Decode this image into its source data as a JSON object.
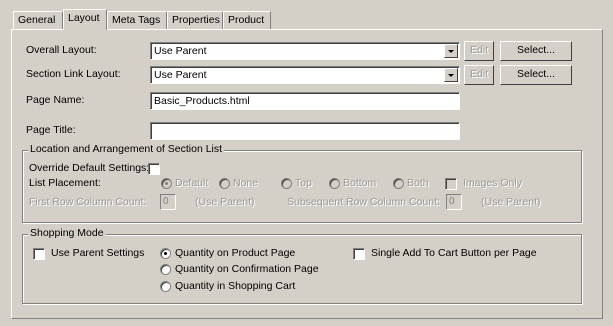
{
  "tabs": [
    "General",
    "Layout",
    "Meta Tags",
    "Properties",
    "Product"
  ],
  "layout": {
    "overall_layout": {
      "label": "Overall Layout:",
      "value": "Use Parent",
      "edit": "Edit",
      "select": "Select..."
    },
    "section_link_layout": {
      "label": "Section Link Layout:",
      "value": "Use Parent",
      "edit": "Edit",
      "select": "Select..."
    },
    "page_name": {
      "label": "Page Name:",
      "value": "Basic_Products.html"
    },
    "page_title": {
      "label": "Page Title:",
      "value": ""
    }
  },
  "location": {
    "title": "Location and Arrangement of Section List",
    "override_label": "Override Default Settings:",
    "list_placement_label": "List Placement:",
    "placement_options": [
      "Default",
      "None",
      "Top",
      "Bottom",
      "Both"
    ],
    "images_only": "Images Only",
    "first_row_label": "First Row Column Count:",
    "first_row_value": "0",
    "first_row_parent": "(Use Parent)",
    "subsequent_label": "Subsequent Row Column Count:",
    "subsequent_value": "0",
    "subsequent_parent": "(Use Parent)"
  },
  "shopping": {
    "title": "Shopping Mode",
    "use_parent": "Use Parent Settings",
    "quantity_options": [
      "Quantity on Product Page",
      "Quantity on Confirmation Page",
      "Quantity in Shopping Cart"
    ],
    "single_add": "Single Add To Cart Button per Page"
  }
}
